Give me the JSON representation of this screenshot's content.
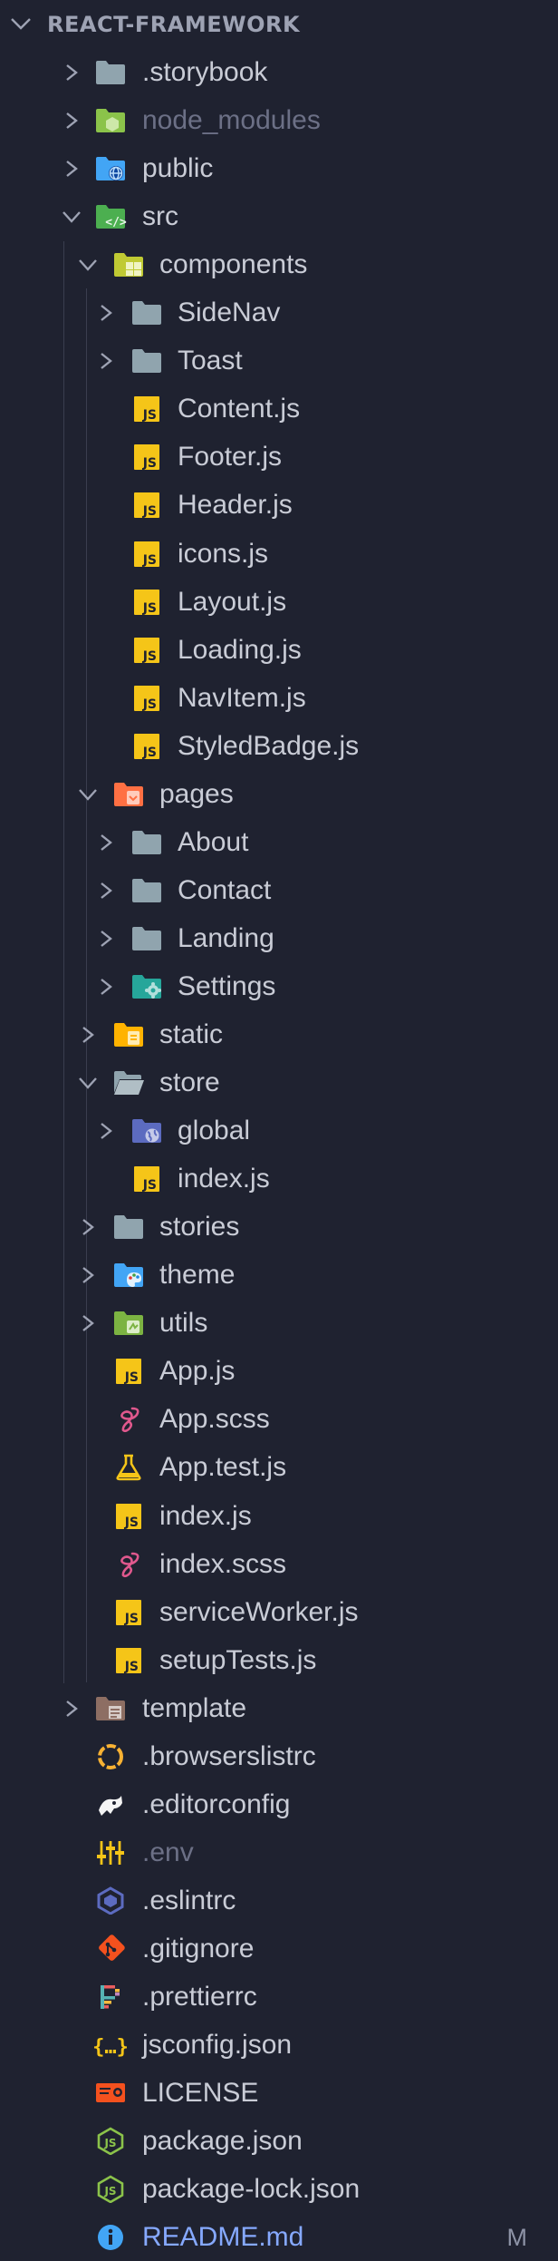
{
  "explorer": {
    "title": "REACT-FRAMEWORK",
    "items": [
      {
        "label": ".storybook",
        "kind": "folder",
        "icon": "folder-icon"
      },
      {
        "label": "node_modules",
        "kind": "folder",
        "icon": "node-folder-icon",
        "dim": true
      },
      {
        "label": "public",
        "kind": "folder",
        "icon": "public-folder-icon"
      },
      {
        "label": "src",
        "kind": "folder",
        "icon": "src-folder-icon",
        "open": true
      },
      {
        "label": "components",
        "kind": "folder",
        "icon": "components-folder-icon",
        "open": true
      },
      {
        "label": "SideNav",
        "kind": "folder",
        "icon": "folder-icon"
      },
      {
        "label": "Toast",
        "kind": "folder",
        "icon": "folder-icon"
      },
      {
        "label": "Content.js",
        "kind": "file",
        "icon": "js-icon"
      },
      {
        "label": "Footer.js",
        "kind": "file",
        "icon": "js-icon"
      },
      {
        "label": "Header.js",
        "kind": "file",
        "icon": "js-icon"
      },
      {
        "label": "icons.js",
        "kind": "file",
        "icon": "js-icon"
      },
      {
        "label": "Layout.js",
        "kind": "file",
        "icon": "js-icon"
      },
      {
        "label": "Loading.js",
        "kind": "file",
        "icon": "js-icon"
      },
      {
        "label": "NavItem.js",
        "kind": "file",
        "icon": "js-icon"
      },
      {
        "label": "StyledBadge.js",
        "kind": "file",
        "icon": "js-icon"
      },
      {
        "label": "pages",
        "kind": "folder",
        "icon": "pages-folder-icon",
        "open": true
      },
      {
        "label": "About",
        "kind": "folder",
        "icon": "folder-icon"
      },
      {
        "label": "Contact",
        "kind": "folder",
        "icon": "folder-icon"
      },
      {
        "label": "Landing",
        "kind": "folder",
        "icon": "folder-icon"
      },
      {
        "label": "Settings",
        "kind": "folder",
        "icon": "settings-folder-icon"
      },
      {
        "label": "static",
        "kind": "folder",
        "icon": "static-folder-icon"
      },
      {
        "label": "store",
        "kind": "folder",
        "icon": "open-folder-icon",
        "open": true
      },
      {
        "label": "global",
        "kind": "folder",
        "icon": "global-folder-icon"
      },
      {
        "label": "index.js",
        "kind": "file",
        "icon": "js-icon"
      },
      {
        "label": "stories",
        "kind": "folder",
        "icon": "folder-icon"
      },
      {
        "label": "theme",
        "kind": "folder",
        "icon": "theme-folder-icon"
      },
      {
        "label": "utils",
        "kind": "folder",
        "icon": "utils-folder-icon"
      },
      {
        "label": "App.js",
        "kind": "file",
        "icon": "js-icon"
      },
      {
        "label": "App.scss",
        "kind": "file",
        "icon": "sass-icon"
      },
      {
        "label": "App.test.js",
        "kind": "file",
        "icon": "test-flask-icon"
      },
      {
        "label": "index.js",
        "kind": "file",
        "icon": "js-icon"
      },
      {
        "label": "index.scss",
        "kind": "file",
        "icon": "sass-icon"
      },
      {
        "label": "serviceWorker.js",
        "kind": "file",
        "icon": "js-icon"
      },
      {
        "label": "setupTests.js",
        "kind": "file",
        "icon": "js-icon"
      },
      {
        "label": "template",
        "kind": "folder",
        "icon": "template-folder-icon"
      },
      {
        "label": ".browserslistrc",
        "kind": "file",
        "icon": "browserslist-icon"
      },
      {
        "label": ".editorconfig",
        "kind": "file",
        "icon": "editorconfig-icon"
      },
      {
        "label": ".env",
        "kind": "file",
        "icon": "env-sliders-icon",
        "dim": true
      },
      {
        "label": ".eslintrc",
        "kind": "file",
        "icon": "eslint-icon"
      },
      {
        "label": ".gitignore",
        "kind": "file",
        "icon": "git-icon"
      },
      {
        "label": ".prettierrc",
        "kind": "file",
        "icon": "prettier-icon"
      },
      {
        "label": "jsconfig.json",
        "kind": "file",
        "icon": "json-braces-icon"
      },
      {
        "label": "LICENSE",
        "kind": "file",
        "icon": "license-icon"
      },
      {
        "label": "package.json",
        "kind": "file",
        "icon": "nodejs-icon"
      },
      {
        "label": "package-lock.json",
        "kind": "file",
        "icon": "nodejs-icon"
      },
      {
        "label": "README.md",
        "kind": "file",
        "icon": "info-icon",
        "blue": true,
        "badge": "M"
      }
    ]
  },
  "colors": {
    "background": "#1f2230",
    "text": "#c9ccd6",
    "dim_text": "#6c7086",
    "modified_text": "#86a9ff",
    "folder_gray": "#90a4ae",
    "js_yellow": "#f5c518",
    "sass_pink": "#e0588d"
  }
}
